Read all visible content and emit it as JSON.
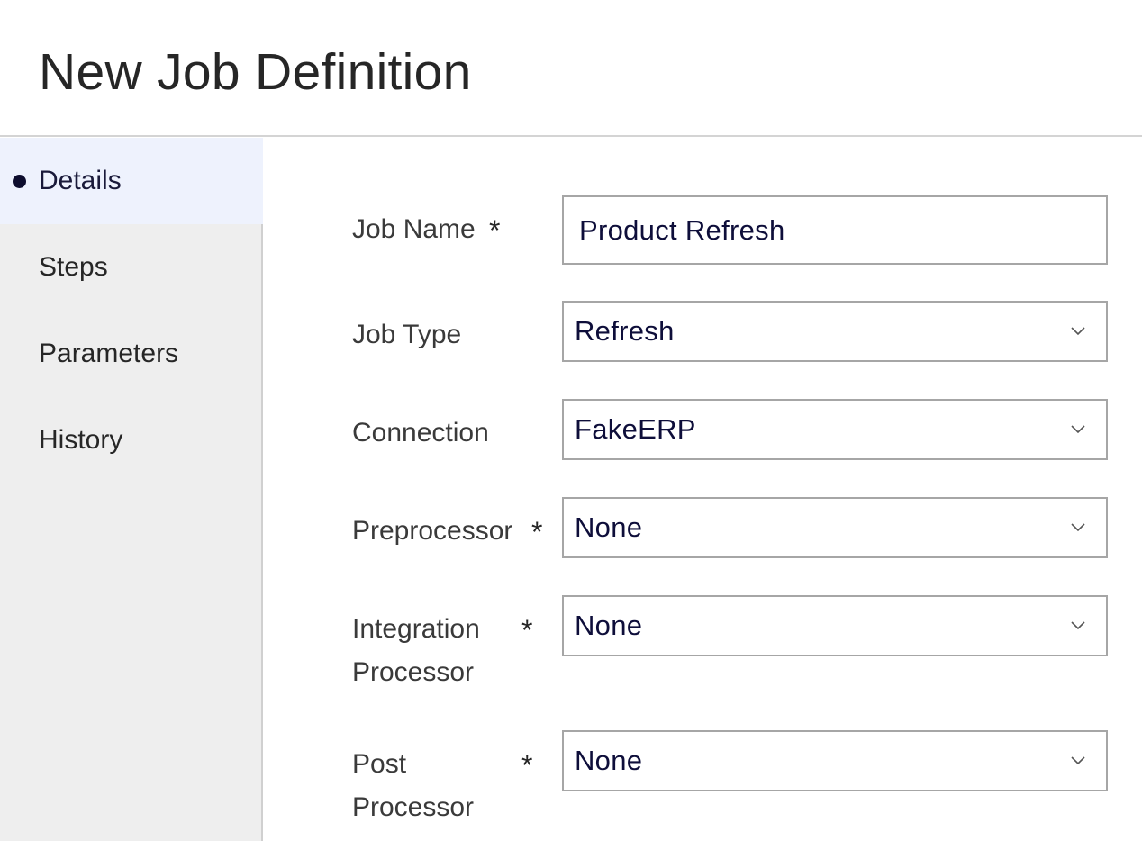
{
  "page": {
    "title": "New Job Definition"
  },
  "sidebar": {
    "items": [
      {
        "label": "Details",
        "active": true
      },
      {
        "label": "Steps",
        "active": false
      },
      {
        "label": "Parameters",
        "active": false
      },
      {
        "label": "History",
        "active": false
      }
    ]
  },
  "form": {
    "required_marker": "*",
    "job_name": {
      "label": "Job Name",
      "value": "Product Refresh",
      "required": true
    },
    "job_type": {
      "label": "Job Type",
      "value": "Refresh",
      "icon": "chevron-down-icon"
    },
    "connection": {
      "label": "Connection",
      "value": "FakeERP",
      "icon": "chevron-down-icon"
    },
    "preprocessor": {
      "label": "Preprocessor",
      "value": "None",
      "required": true,
      "icon": "chevron-down-icon"
    },
    "integration_processor": {
      "label_line1": "Integration",
      "label_line2": "Processor",
      "value": "None",
      "required": true,
      "icon": "chevron-down-icon"
    },
    "post_processor": {
      "label_line1": "Post",
      "label_line2": "Processor",
      "value": "None",
      "required": true,
      "icon": "chevron-down-icon"
    }
  },
  "colors": {
    "active_nav_bg": "#eef2fd",
    "sidebar_bg": "#eeeeee",
    "input_border": "#a6a6a6",
    "value_text": "#0e0e3a"
  }
}
